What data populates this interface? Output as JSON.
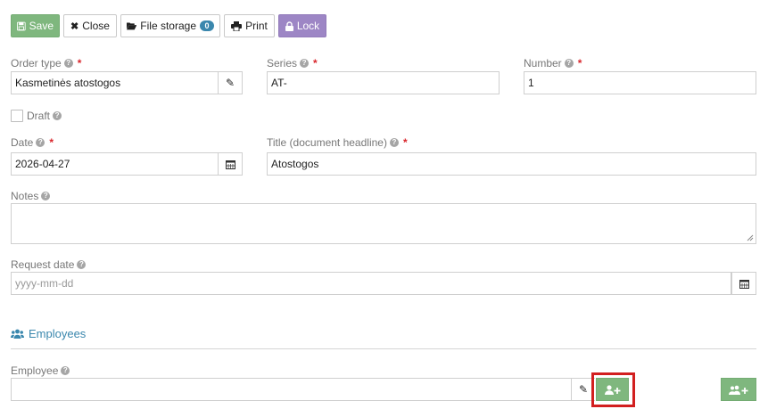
{
  "toolbar": {
    "save": "Save",
    "close": "Close",
    "file_storage": "File storage",
    "file_count": "0",
    "print": "Print",
    "lock": "Lock"
  },
  "form": {
    "order_type": {
      "label": "Order type",
      "value": "Kasmetinės atostogos"
    },
    "series": {
      "label": "Series",
      "value": "AT-"
    },
    "number": {
      "label": "Number",
      "value": "1"
    },
    "draft": {
      "label": "Draft",
      "checked": false
    },
    "date": {
      "label": "Date",
      "value": "2026-04-27"
    },
    "title": {
      "label": "Title (document headline)",
      "value": "Atostogos"
    },
    "notes": {
      "label": "Notes",
      "value": ""
    },
    "request_date": {
      "label": "Request date",
      "placeholder": "yyyy-mm-dd",
      "value": ""
    }
  },
  "employees": {
    "section_title": "Employees",
    "employee_label": "Employee",
    "employee_value": ""
  },
  "icons": {
    "help": "question-circle-icon",
    "required_mark": "*"
  },
  "colors": {
    "green": "#7fb77e",
    "purple": "#9d86c5",
    "blue": "#3a87ad",
    "required": "#d9262c",
    "highlight": "#d21f1f"
  }
}
